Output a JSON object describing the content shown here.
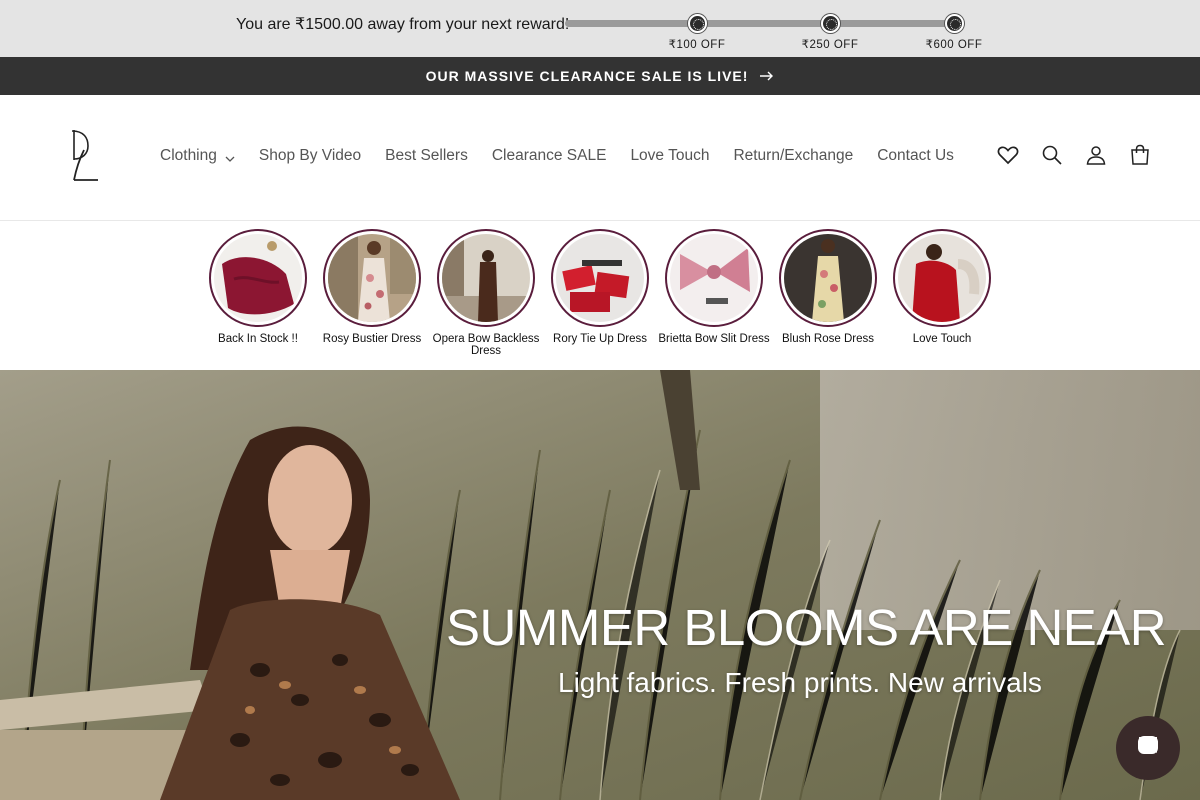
{
  "reward": {
    "message": "You are ₹1500.00 away from your next reward!",
    "milestones": [
      "₹100 OFF",
      "₹250 OFF",
      "₹600 OFF"
    ]
  },
  "announcement": {
    "text": "OUR MASSIVE CLEARANCE SALE IS LIVE!",
    "arrow_icon": "arrow-right-icon"
  },
  "header": {
    "logo_icon": "brand-logo-icon",
    "nav": [
      "Clothing",
      "Shop By Video",
      "Best Sellers",
      "Clearance SALE",
      "Love Touch",
      "Return/Exchange",
      "Contact Us"
    ],
    "icons": [
      "heart-icon",
      "search-icon",
      "account-icon",
      "cart-icon"
    ]
  },
  "stories": [
    {
      "label": "Back In Stock !!"
    },
    {
      "label": "Rosy Bustier Dress"
    },
    {
      "label": "Opera Bow Backless Dress"
    },
    {
      "label": "Rory Tie Up Dress"
    },
    {
      "label": "Brietta Bow Slit Dress"
    },
    {
      "label": "Blush Rose Dress"
    },
    {
      "label": "Love Touch"
    }
  ],
  "hero": {
    "title": "SUMMER BLOOMS ARE NEAR",
    "subtitle": "Light fabrics. Fresh prints. New arrivals"
  },
  "chat": {
    "icon": "chat-icon"
  },
  "colors": {
    "announcement_bg": "#333333",
    "story_ring": "#5a1d3c",
    "reward_bg": "#e4e4e4"
  }
}
